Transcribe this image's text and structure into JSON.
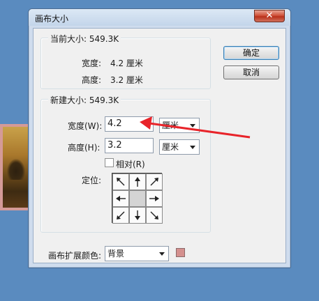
{
  "window": {
    "title": "画布大小"
  },
  "current_size": {
    "legend": "当前大小: 549.3K",
    "width_label": "宽度:",
    "width_value": "4.2 厘米",
    "height_label": "高度:",
    "height_value": "3.2 厘米"
  },
  "buttons": {
    "ok": "确定",
    "cancel": "取消"
  },
  "new_size": {
    "legend": "新建大小: 549.3K",
    "width_label": "宽度(W):",
    "width_value": "4.2",
    "width_unit": "厘米",
    "height_label": "高度(H):",
    "height_value": "3.2",
    "height_unit": "厘米",
    "relative_label": "相对(R)",
    "relative_checked": false,
    "anchor_label": "定位:"
  },
  "extension": {
    "label": "画布扩展颜色:",
    "value": "背景",
    "swatch_color": "#d4908e"
  },
  "colors": {
    "annotation_arrow": "#e8242a"
  }
}
